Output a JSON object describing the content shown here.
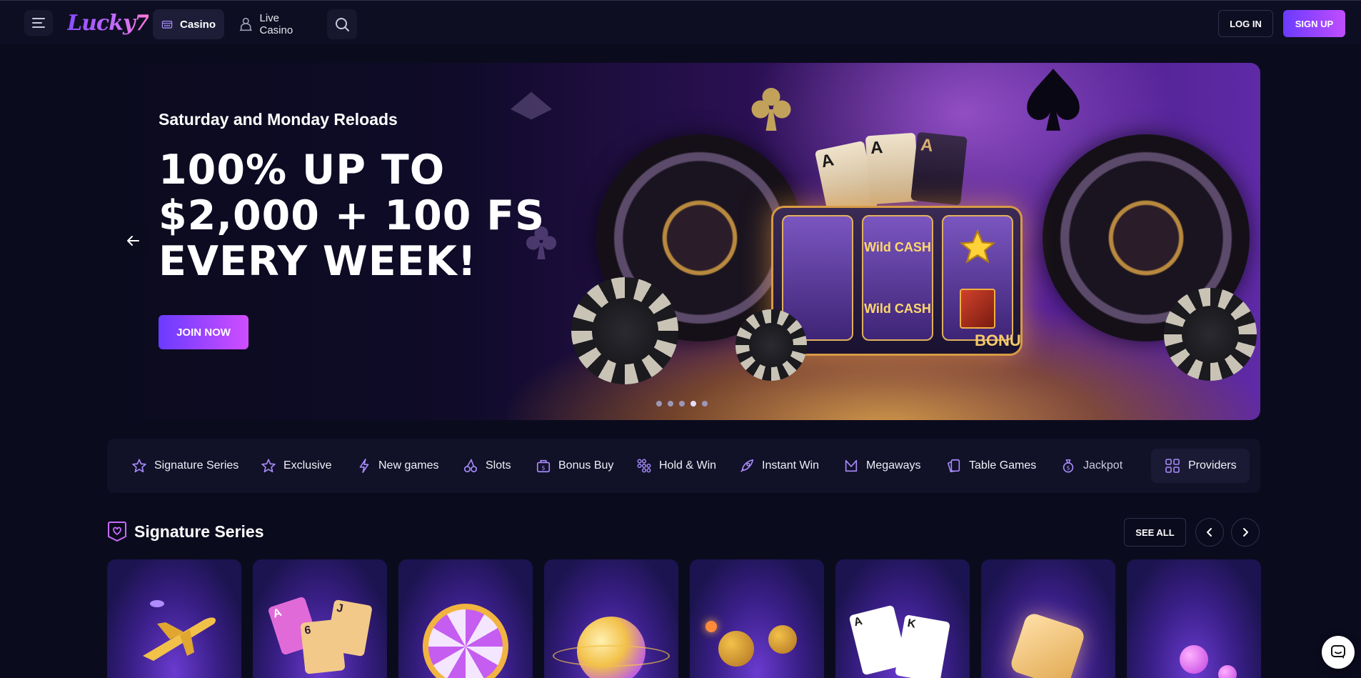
{
  "header": {
    "logo_text": "Lucky7",
    "tabs": [
      {
        "label": "Casino",
        "icon": "casino-icon",
        "active": true
      },
      {
        "label": "Live Casino",
        "icon": "dealer-icon",
        "active": false
      }
    ],
    "login_label": "LOG IN",
    "signup_label": "SIGN UP"
  },
  "hero": {
    "subtitle": "Saturday and Monday Reloads",
    "title_lines": [
      "100% UP TO",
      "$2,000 + 100 FS",
      "EVERY WEEK!"
    ],
    "cta_label": "JOIN NOW",
    "slides": 5,
    "active_slide": 4,
    "art_reel_texts": [
      "Wild CASH",
      "Wild CASH"
    ],
    "art_bonus_text": "BONU"
  },
  "categories": [
    {
      "label": "Signature Series",
      "icon": "star-outline-icon"
    },
    {
      "label": "Exclusive",
      "icon": "star-outline-icon"
    },
    {
      "label": "New games",
      "icon": "lightning-icon"
    },
    {
      "label": "Slots",
      "icon": "cherries-icon"
    },
    {
      "label": "Bonus Buy",
      "icon": "bonus-bag-icon"
    },
    {
      "label": "Hold & Win",
      "icon": "grid-dots-icon"
    },
    {
      "label": "Instant Win",
      "icon": "rocket-icon"
    },
    {
      "label": "Megaways",
      "icon": "crown-m-icon"
    },
    {
      "label": "Table Games",
      "icon": "cards-icon"
    },
    {
      "label": "Jackpot",
      "icon": "money-bag-icon"
    }
  ],
  "providers_label": "Providers",
  "section": {
    "title": "Signature Series",
    "see_all_label": "SEE ALL"
  },
  "games": [
    {
      "name": "airplane-game"
    },
    {
      "name": "cards-game"
    },
    {
      "name": "wheel-game"
    },
    {
      "name": "soccer-game"
    },
    {
      "name": "bombs-game"
    },
    {
      "name": "poker-cards-game"
    },
    {
      "name": "dice-game"
    },
    {
      "name": "plinko-game"
    }
  ],
  "colors": {
    "background": "#0b0b1e",
    "accent_start": "#6a3bff",
    "accent_end": "#c14dff",
    "icon_purple": "#a78bfa"
  }
}
